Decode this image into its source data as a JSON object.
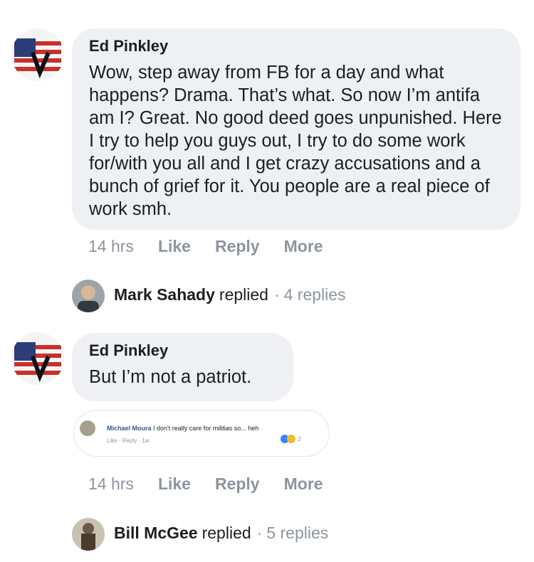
{
  "comments": [
    {
      "author": "Ed Pinkley",
      "text": "Wow, step away from FB for a day and what happens? Drama. That’s what. So now I’m antifa am I? Great. No good deed goes unpunished. Here I try to help you guys out, I try to do some work for/with you all and I get crazy accusations and a bunch of grief for it. You people are a real piece of work smh.",
      "time": "14 hrs",
      "like": "Like",
      "reply": "Reply",
      "more": "More",
      "replies_preview": {
        "name": "Mark Sahady",
        "replied": "replied",
        "count": "4 replies"
      }
    },
    {
      "author": "Ed Pinkley",
      "text": "But I’m not a patriot.",
      "time": "14 hrs",
      "like": "Like",
      "reply": "Reply",
      "more": "More",
      "embedded": {
        "name": "Michael Moura",
        "text": "I don't really care for militias so... heh",
        "actions": "Like · Reply · 1w",
        "reaction_count": "2"
      },
      "replies_preview": {
        "name": "Bill McGee",
        "replied": "replied",
        "count": "5 replies"
      }
    }
  ],
  "colors": {
    "bubble": "#eef0f4",
    "meta": "#8d949e",
    "text": "#1c1e21",
    "link_blue": "#385898"
  },
  "icons": [
    "flag-avatar-icon",
    "profile-photo-icon",
    "like-reaction-icon",
    "wow-reaction-icon"
  ]
}
